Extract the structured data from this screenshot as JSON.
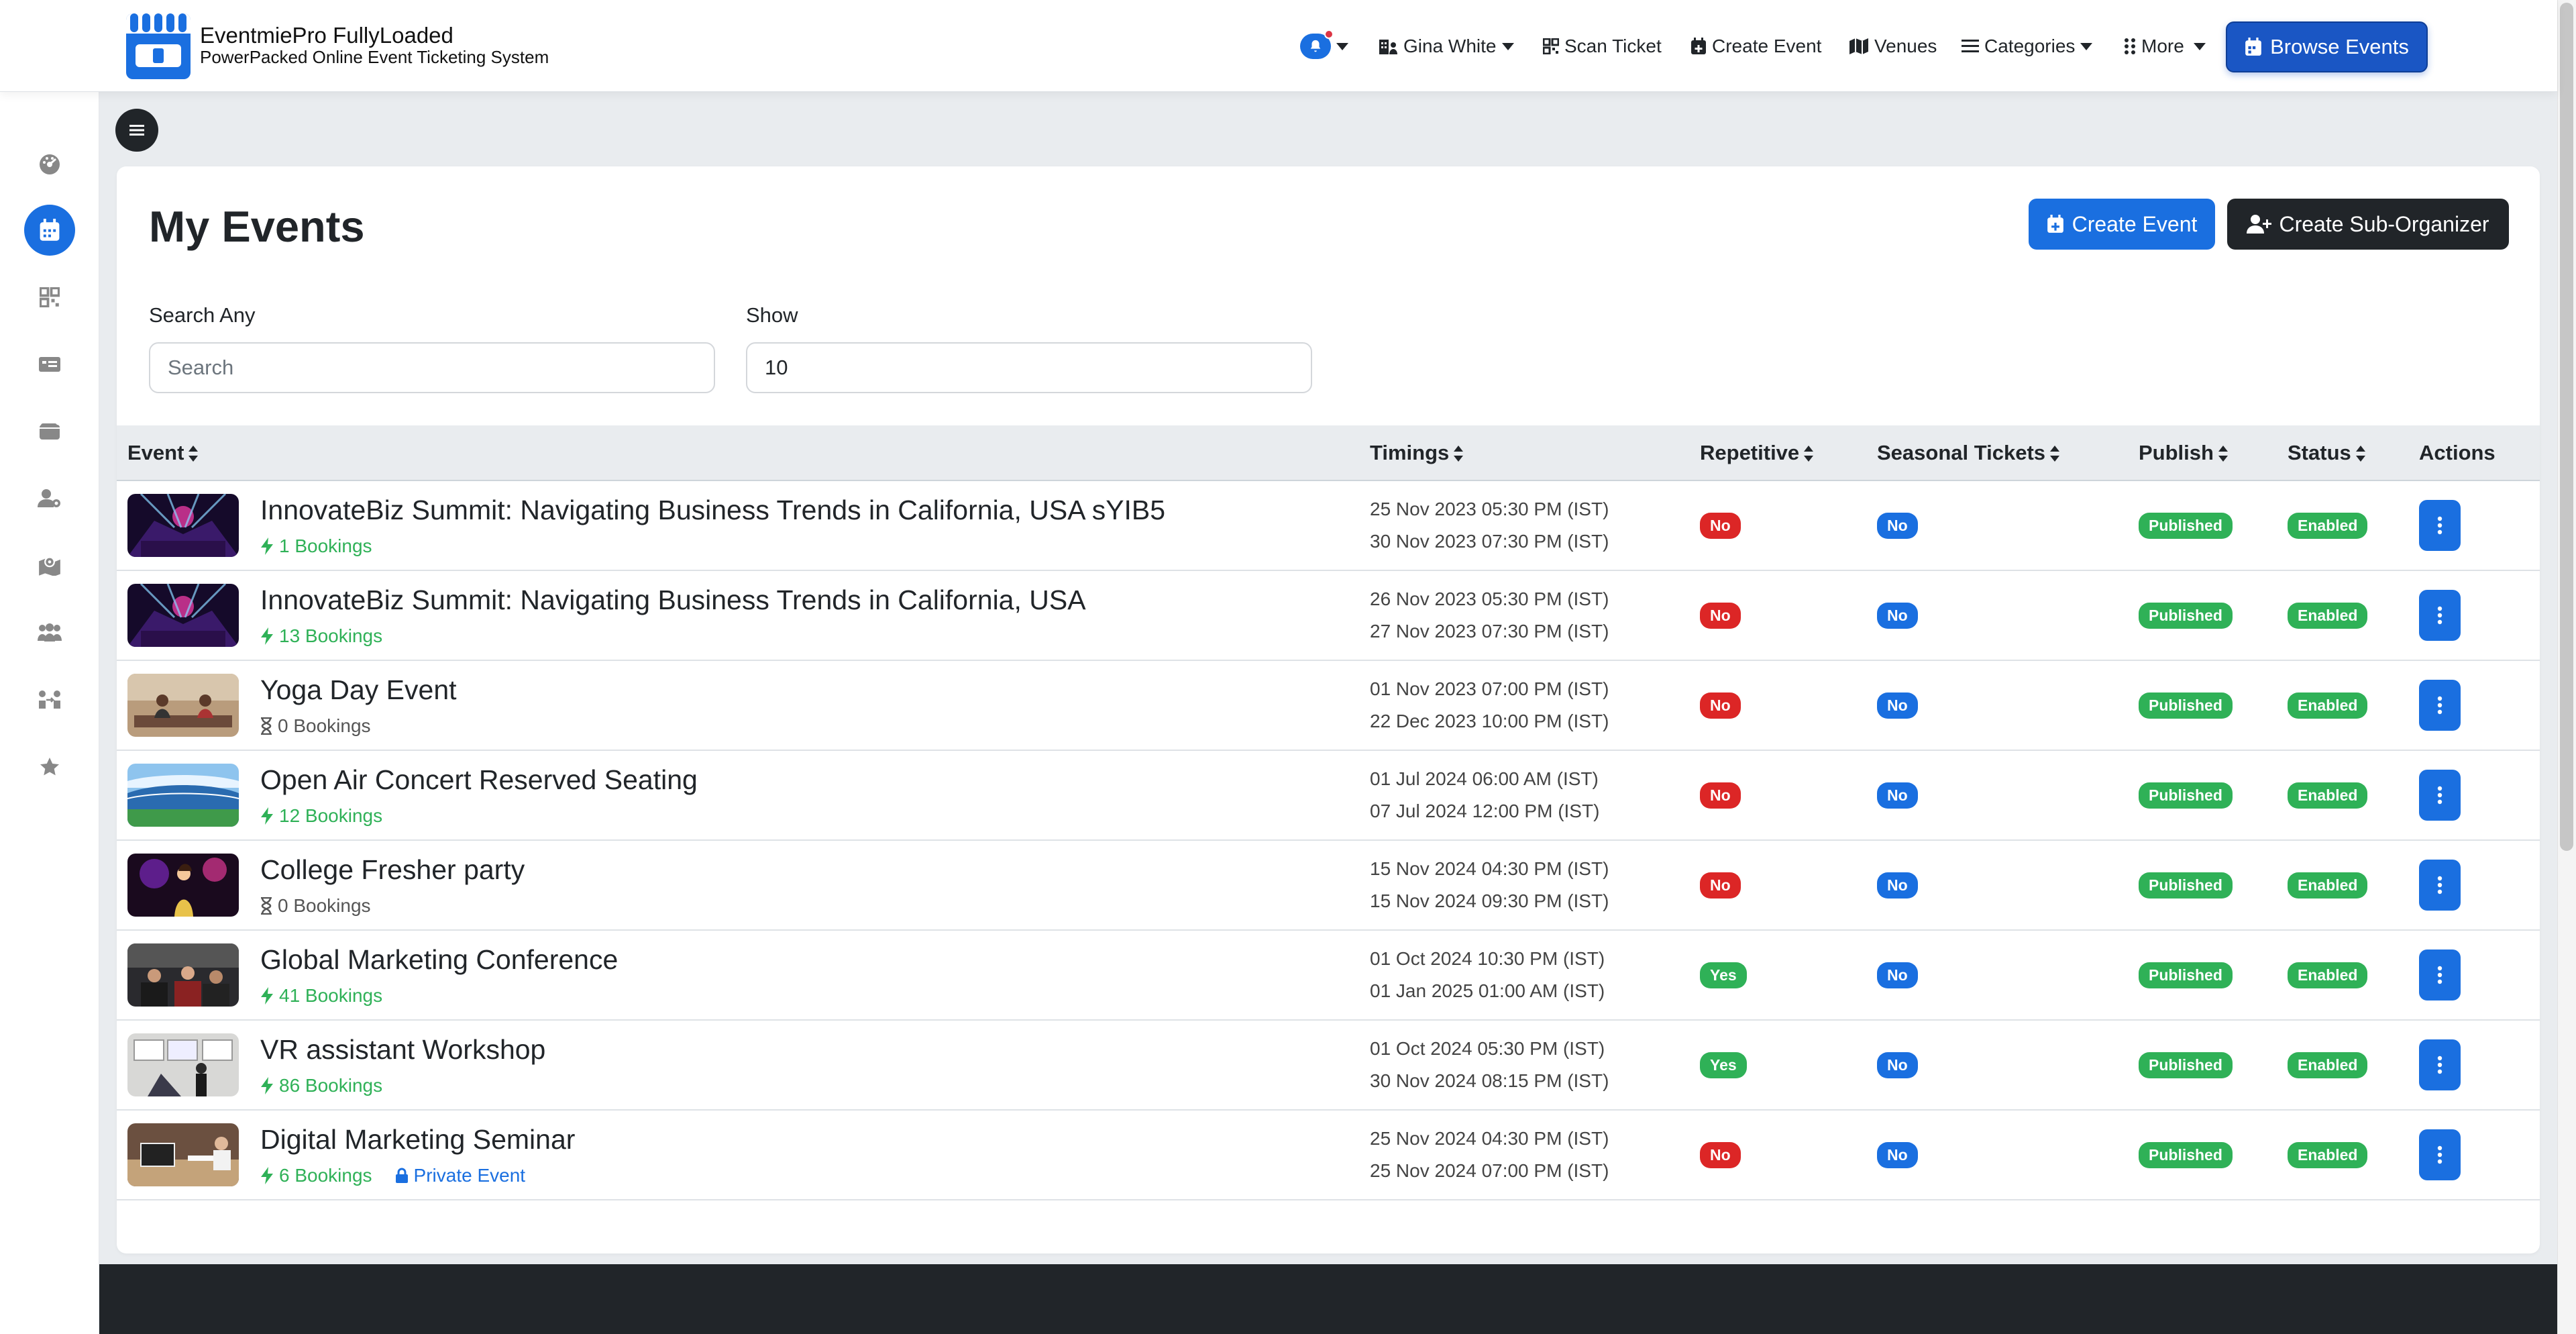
{
  "brand": {
    "title": "EventmiePro FullyLoaded",
    "subtitle": "PowerPacked Online Event Ticketing System"
  },
  "topnav": {
    "user": "Gina White",
    "scan_ticket": "Scan Ticket",
    "create_event": "Create Event",
    "venues": "Venues",
    "categories": "Categories",
    "more": "More",
    "browse_events": "Browse Events"
  },
  "sidebar": {
    "items": [
      "dashboard-icon",
      "calendar-icon",
      "qr-code-icon",
      "ticket-icon",
      "wallet-icon",
      "user-cog-icon",
      "map-icon",
      "users-icon",
      "people-arrows-icon",
      "star-icon"
    ],
    "active_index": 1
  },
  "page": {
    "title": "My Events",
    "create_event_btn": "Create Event",
    "create_sub_organizer_btn": "Create Sub-Organizer",
    "search_label": "Search Any",
    "search_placeholder": "Search",
    "show_label": "Show",
    "show_value": "10"
  },
  "table": {
    "headers": {
      "event": "Event",
      "timings": "Timings",
      "repetitive": "Repetitive",
      "seasonal": "Seasonal Tickets",
      "publish": "Publish",
      "status": "Status",
      "actions": "Actions"
    },
    "rows": [
      {
        "name": "InnovateBiz Summit: Navigating Business Trends in California, USA sYIB5",
        "bookings": "1 Bookings",
        "booking_style": "green",
        "start": "25 Nov 2023 05:30 PM (IST)",
        "end": "30 Nov 2023 07:30 PM (IST)",
        "repetitive": "No",
        "seasonal": "No",
        "publish": "Published",
        "status": "Enabled",
        "thumb": "concert-stage",
        "private": ""
      },
      {
        "name": "InnovateBiz Summit: Navigating Business Trends in California, USA",
        "bookings": "13 Bookings",
        "booking_style": "green",
        "start": "26 Nov 2023 05:30 PM (IST)",
        "end": "27 Nov 2023 07:30 PM (IST)",
        "repetitive": "No",
        "seasonal": "No",
        "publish": "Published",
        "status": "Enabled",
        "thumb": "concert-stage",
        "private": ""
      },
      {
        "name": "Yoga Day Event",
        "bookings": "0 Bookings",
        "booking_style": "gray",
        "start": "01 Nov 2023 07:00 PM (IST)",
        "end": "22 Dec 2023 10:00 PM (IST)",
        "repetitive": "No",
        "seasonal": "No",
        "publish": "Published",
        "status": "Enabled",
        "thumb": "yoga",
        "private": ""
      },
      {
        "name": "Open Air Concert Reserved Seating",
        "bookings": "12 Bookings",
        "booking_style": "green",
        "start": "01 Jul 2024 06:00 AM (IST)",
        "end": "07 Jul 2024 12:00 PM (IST)",
        "repetitive": "No",
        "seasonal": "No",
        "publish": "Published",
        "status": "Enabled",
        "thumb": "stadium",
        "private": ""
      },
      {
        "name": "College Fresher party",
        "bookings": "0 Bookings",
        "booking_style": "gray",
        "start": "15 Nov 2024 04:30 PM (IST)",
        "end": "15 Nov 2024 09:30 PM (IST)",
        "repetitive": "No",
        "seasonal": "No",
        "publish": "Published",
        "status": "Enabled",
        "thumb": "party",
        "private": ""
      },
      {
        "name": "Global Marketing Conference",
        "bookings": "41 Bookings",
        "booking_style": "green",
        "start": "01 Oct 2024 10:30 PM (IST)",
        "end": "01 Jan 2025 01:00 AM (IST)",
        "repetitive": "Yes",
        "seasonal": "No",
        "publish": "Published",
        "status": "Enabled",
        "thumb": "conference",
        "private": ""
      },
      {
        "name": "VR assistant Workshop",
        "bookings": "86 Bookings",
        "booking_style": "green",
        "start": "01 Oct 2024 05:30 PM (IST)",
        "end": "30 Nov 2024 08:15 PM (IST)",
        "repetitive": "Yes",
        "seasonal": "No",
        "publish": "Published",
        "status": "Enabled",
        "thumb": "workshop",
        "private": ""
      },
      {
        "name": "Digital Marketing Seminar",
        "bookings": "6 Bookings",
        "booking_style": "green",
        "start": "25 Nov 2024 04:30 PM (IST)",
        "end": "25 Nov 2024 07:00 PM (IST)",
        "repetitive": "No",
        "seasonal": "No",
        "publish": "Published",
        "status": "Enabled",
        "thumb": "seminar",
        "private": "Private Event"
      }
    ]
  },
  "colors": {
    "primary": "#1a6fe0",
    "danger": "#dc2626",
    "success": "#2fb157",
    "dark": "#212529"
  }
}
